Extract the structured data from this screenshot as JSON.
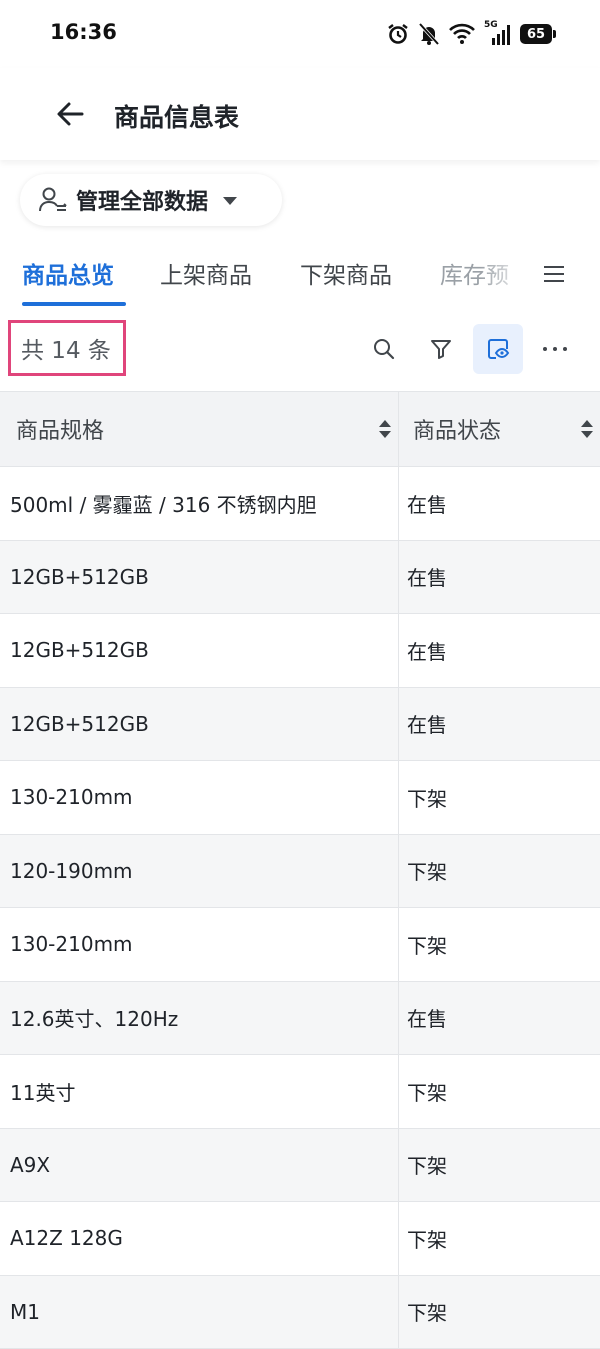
{
  "status_bar": {
    "time": "16:36",
    "network": "5G",
    "battery": "65"
  },
  "header": {
    "title": "商品信息表"
  },
  "view_selector": {
    "label": "管理全部数据"
  },
  "tabs": [
    {
      "label": "商品总览",
      "active": true
    },
    {
      "label": "上架商品",
      "active": false
    },
    {
      "label": "下架商品",
      "active": false
    },
    {
      "label": "库存预",
      "active": false
    }
  ],
  "toolbar": {
    "count_text": "共 14 条"
  },
  "table": {
    "columns": [
      "商品规格",
      "商品状态"
    ],
    "rows": [
      {
        "spec": "500ml / 雾霾蓝 / 316 不锈钢内胆",
        "status": "在售"
      },
      {
        "spec": "12GB+512GB",
        "status": "在售"
      },
      {
        "spec": "12GB+512GB",
        "status": "在售"
      },
      {
        "spec": "12GB+512GB",
        "status": "在售"
      },
      {
        "spec": "130-210mm",
        "status": "下架"
      },
      {
        "spec": "120-190mm",
        "status": "下架"
      },
      {
        "spec": "130-210mm",
        "status": "下架"
      },
      {
        "spec": "12.6英寸、120Hz",
        "status": "在售"
      },
      {
        "spec": "11英寸",
        "status": "下架"
      },
      {
        "spec": "A9X",
        "status": "下架"
      },
      {
        "spec": "A12Z 128G",
        "status": "下架"
      },
      {
        "spec": "M1",
        "status": "下架"
      }
    ]
  },
  "colors": {
    "accent": "#1e6fd9",
    "highlight_border": "#e0457b"
  }
}
